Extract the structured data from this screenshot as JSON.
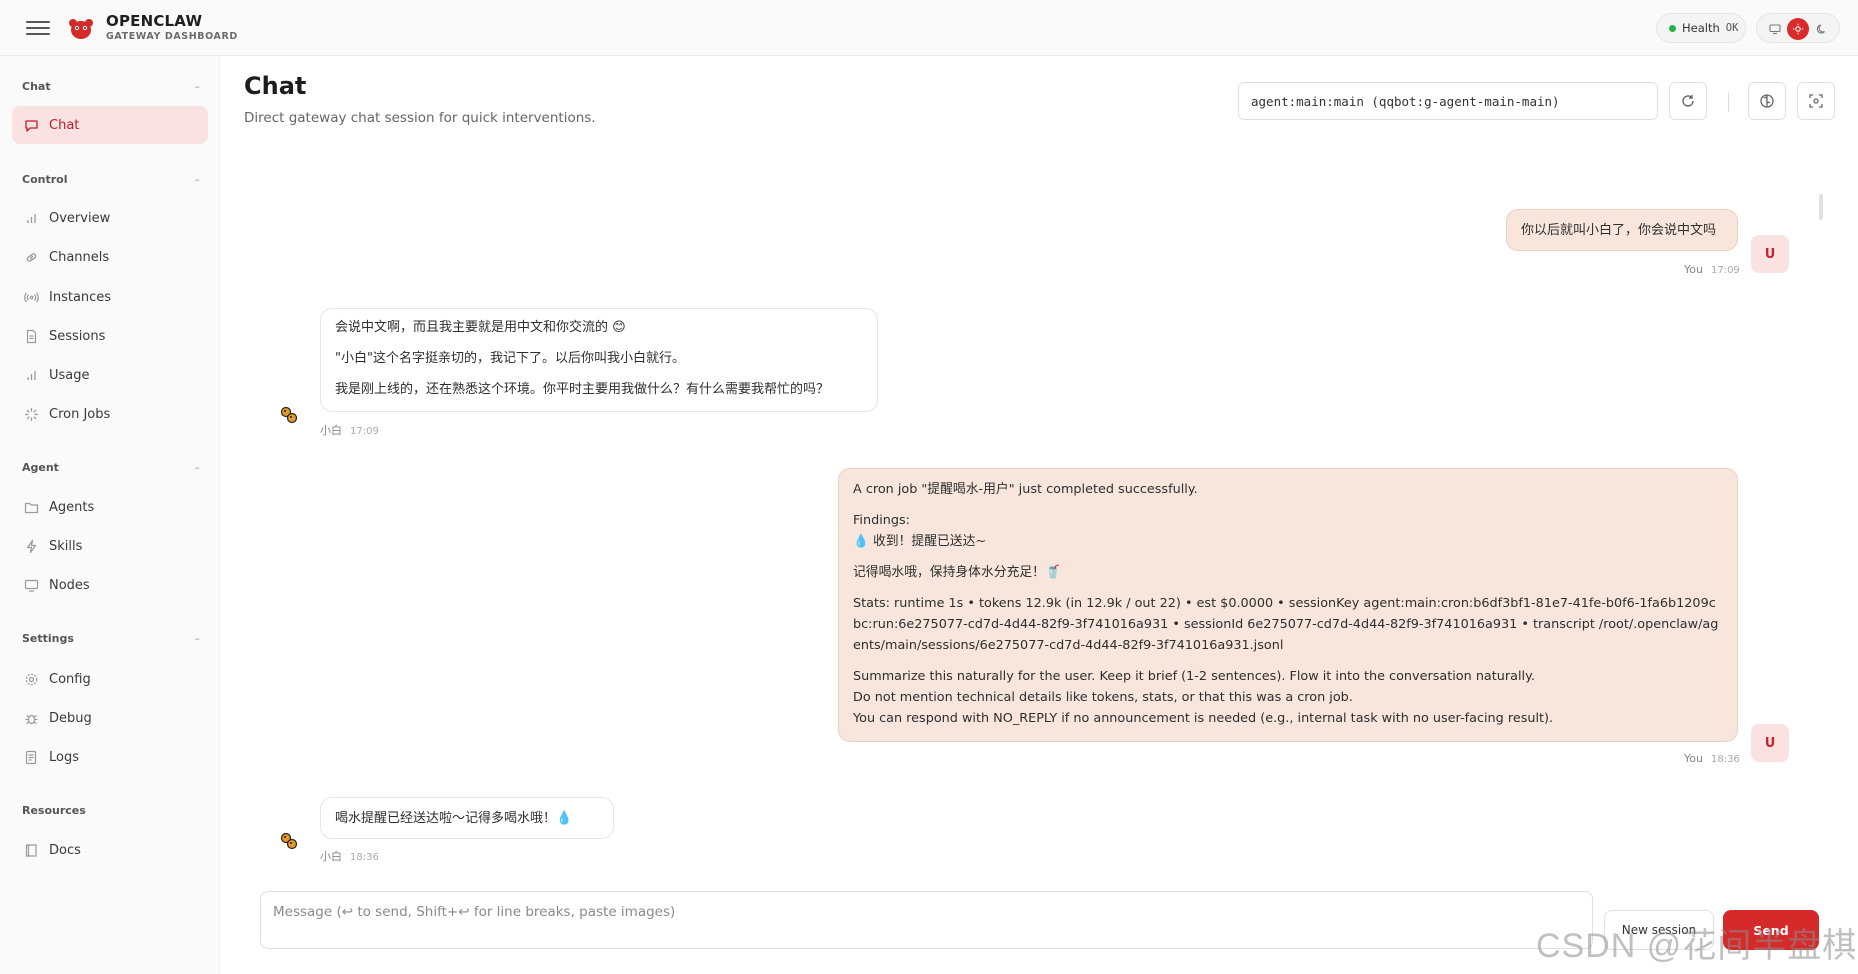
{
  "brand": {
    "name": "OPENCLAW",
    "subtitle": "GATEWAY DASHBOARD"
  },
  "topbar": {
    "health_label": "Health",
    "health_status": "OK",
    "theme_icons": [
      "monitor-icon",
      "sun-icon",
      "moon-icon"
    ]
  },
  "sidebar": {
    "sections": [
      {
        "title": "Chat",
        "collapse": "–",
        "items": [
          {
            "label": "Chat",
            "icon": "chat-icon",
            "active": true
          }
        ]
      },
      {
        "title": "Control",
        "collapse": "–",
        "items": [
          {
            "label": "Overview",
            "icon": "bar-chart-icon"
          },
          {
            "label": "Channels",
            "icon": "link-icon"
          },
          {
            "label": "Instances",
            "icon": "broadcast-icon"
          },
          {
            "label": "Sessions",
            "icon": "document-icon"
          },
          {
            "label": "Usage",
            "icon": "bar-chart-icon"
          },
          {
            "label": "Cron Jobs",
            "icon": "loader-icon"
          }
        ]
      },
      {
        "title": "Agent",
        "collapse": "–",
        "items": [
          {
            "label": "Agents",
            "icon": "folder-icon"
          },
          {
            "label": "Skills",
            "icon": "lightning-icon"
          },
          {
            "label": "Nodes",
            "icon": "monitor-icon"
          }
        ]
      },
      {
        "title": "Settings",
        "collapse": "–",
        "items": [
          {
            "label": "Config",
            "icon": "gear-icon"
          },
          {
            "label": "Debug",
            "icon": "bug-icon"
          },
          {
            "label": "Logs",
            "icon": "log-icon"
          }
        ]
      },
      {
        "title": "Resources",
        "items": [
          {
            "label": "Docs",
            "icon": "book-icon"
          }
        ]
      }
    ]
  },
  "header": {
    "title": "Chat",
    "subtitle": "Direct gateway chat session for quick interventions.",
    "session_value": "agent:main:main (qqbot:g-agent-main-main)",
    "actions": [
      "refresh-icon",
      "brain-icon",
      "focus-icon"
    ]
  },
  "messages": [
    {
      "role": "user",
      "author": "You",
      "time": "17:09",
      "avatar": "U",
      "paragraphs": [
        "你以后就叫小白了，你会说中文吗"
      ]
    },
    {
      "role": "assistant",
      "author": "小白",
      "time": "17:09",
      "paragraphs": [
        "会说中文啊，而且我主要就是用中文和你交流的 😊",
        "\"小白\"这个名字挺亲切的，我记下了。以后你叫我小白就行。",
        "我是刚上线的，还在熟悉这个环境。你平时主要用我做什么？有什么需要我帮忙的吗？"
      ]
    },
    {
      "role": "user",
      "author": "You",
      "time": "18:36",
      "avatar": "U",
      "paragraphs": [
        "A cron job \"提醒喝水-用户\" just completed successfully.",
        "Findings:\n💧 收到！提醒已送达~",
        "记得喝水哦，保持身体水分充足！🥤",
        "Stats: runtime 1s • tokens 12.9k (in 12.9k / out 22) • est $0.0000 • sessionKey agent:main:cron:b6df3bf1-81e7-41fe-b0f6-1fa6b1209cbc:run:6e275077-cd7d-4d44-82f9-3f741016a931 • sessionId 6e275077-cd7d-4d44-82f9-3f741016a931 • transcript /root/.openclaw/agents/main/sessions/6e275077-cd7d-4d44-82f9-3f741016a931.jsonl",
        "Summarize this naturally for the user. Keep it brief (1-2 sentences). Flow it into the conversation naturally.\nDo not mention technical details like tokens, stats, or that this was a cron job.\nYou can respond with NO_REPLY if no announcement is needed (e.g., internal task with no user-facing result)."
      ]
    },
    {
      "role": "assistant",
      "author": "小白",
      "time": "18:36",
      "paragraphs": [
        "喝水提醒已经送达啦～记得多喝水哦！💧"
      ]
    }
  ],
  "composer": {
    "placeholder": "Message (↩ to send, Shift+↩ for line breaks, paste images)",
    "new_session_label": "New session",
    "send_label": "Send"
  },
  "watermark": "CSDN @花间半盘棋",
  "colors": {
    "accent": "#d62a2a",
    "active_nav_bg": "#fbe2e2",
    "user_bubble_bg": "#f8e6dc",
    "health_ok": "#22b14c"
  }
}
